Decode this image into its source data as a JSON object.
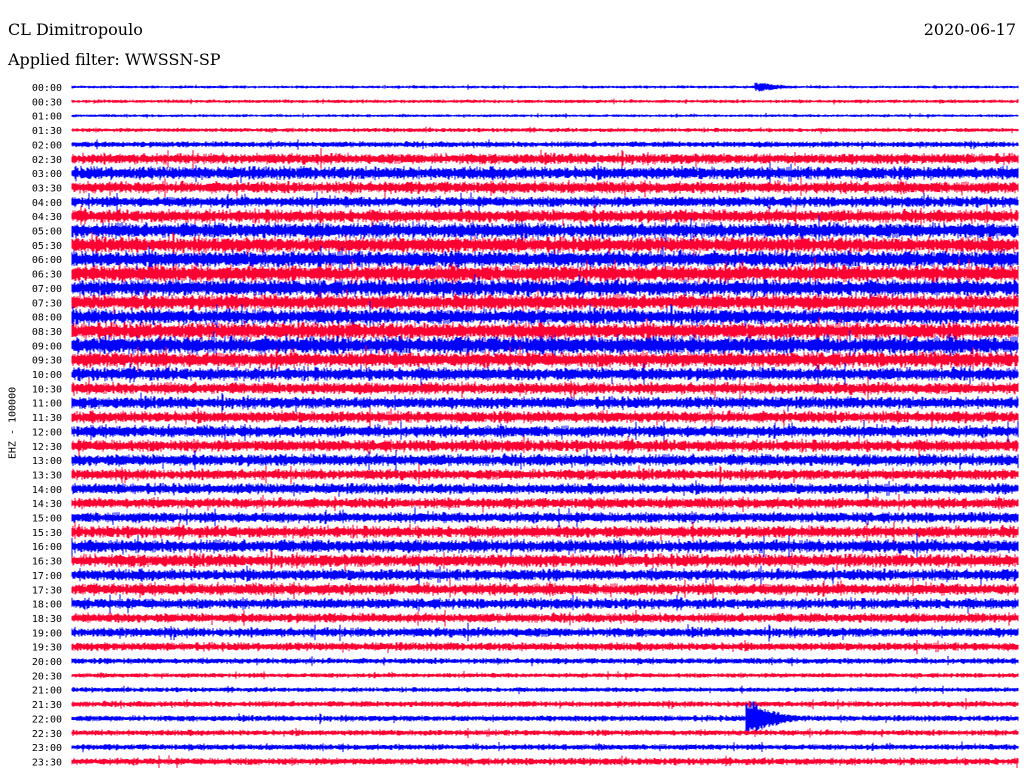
{
  "header": {
    "station": "CL Dimitropoulo",
    "date": "2020-06-17",
    "filter": "Applied filter: WWSSN-SP"
  },
  "chart_data": {
    "type": "line",
    "title": "CL Dimitropoulo",
    "ylabel": "EHZ - 100000",
    "xlabel": "",
    "grid": false,
    "colors": [
      "#0000ff",
      "#ff0033"
    ],
    "trace_start_times": [
      "00:00",
      "00:30",
      "01:00",
      "01:30",
      "02:00",
      "02:30",
      "03:00",
      "03:30",
      "04:00",
      "04:30",
      "05:00",
      "05:30",
      "06:00",
      "06:30",
      "07:00",
      "07:30",
      "08:00",
      "08:30",
      "09:00",
      "09:30",
      "10:00",
      "10:30",
      "11:00",
      "11:30",
      "12:00",
      "12:30",
      "13:00",
      "13:30",
      "14:00",
      "14:30",
      "15:00",
      "15:30",
      "16:00",
      "16:30",
      "17:00",
      "17:30",
      "18:00",
      "18:30",
      "19:00",
      "19:30",
      "20:00",
      "20:30",
      "21:00",
      "21:30",
      "22:00",
      "22:30",
      "23:00",
      "23:30"
    ],
    "relative_noise_level": [
      0.25,
      0.3,
      0.25,
      0.35,
      0.5,
      0.9,
      1.1,
      1.0,
      0.9,
      1.1,
      1.3,
      1.3,
      1.4,
      1.4,
      1.4,
      1.3,
      1.3,
      1.4,
      1.5,
      1.3,
      1.1,
      1.0,
      1.0,
      1.0,
      1.0,
      1.0,
      1.0,
      0.9,
      0.9,
      0.9,
      0.9,
      1.0,
      1.1,
      1.1,
      1.0,
      1.0,
      0.9,
      0.8,
      0.8,
      0.7,
      0.5,
      0.4,
      0.4,
      0.5,
      0.5,
      0.5,
      0.5,
      0.6
    ],
    "events": [
      {
        "time": "00:00",
        "fraction_of_trace": 0.73,
        "amplitude": 3
      },
      {
        "time": "22:00",
        "fraction_of_trace": 0.72,
        "amplitude": 6
      }
    ]
  }
}
